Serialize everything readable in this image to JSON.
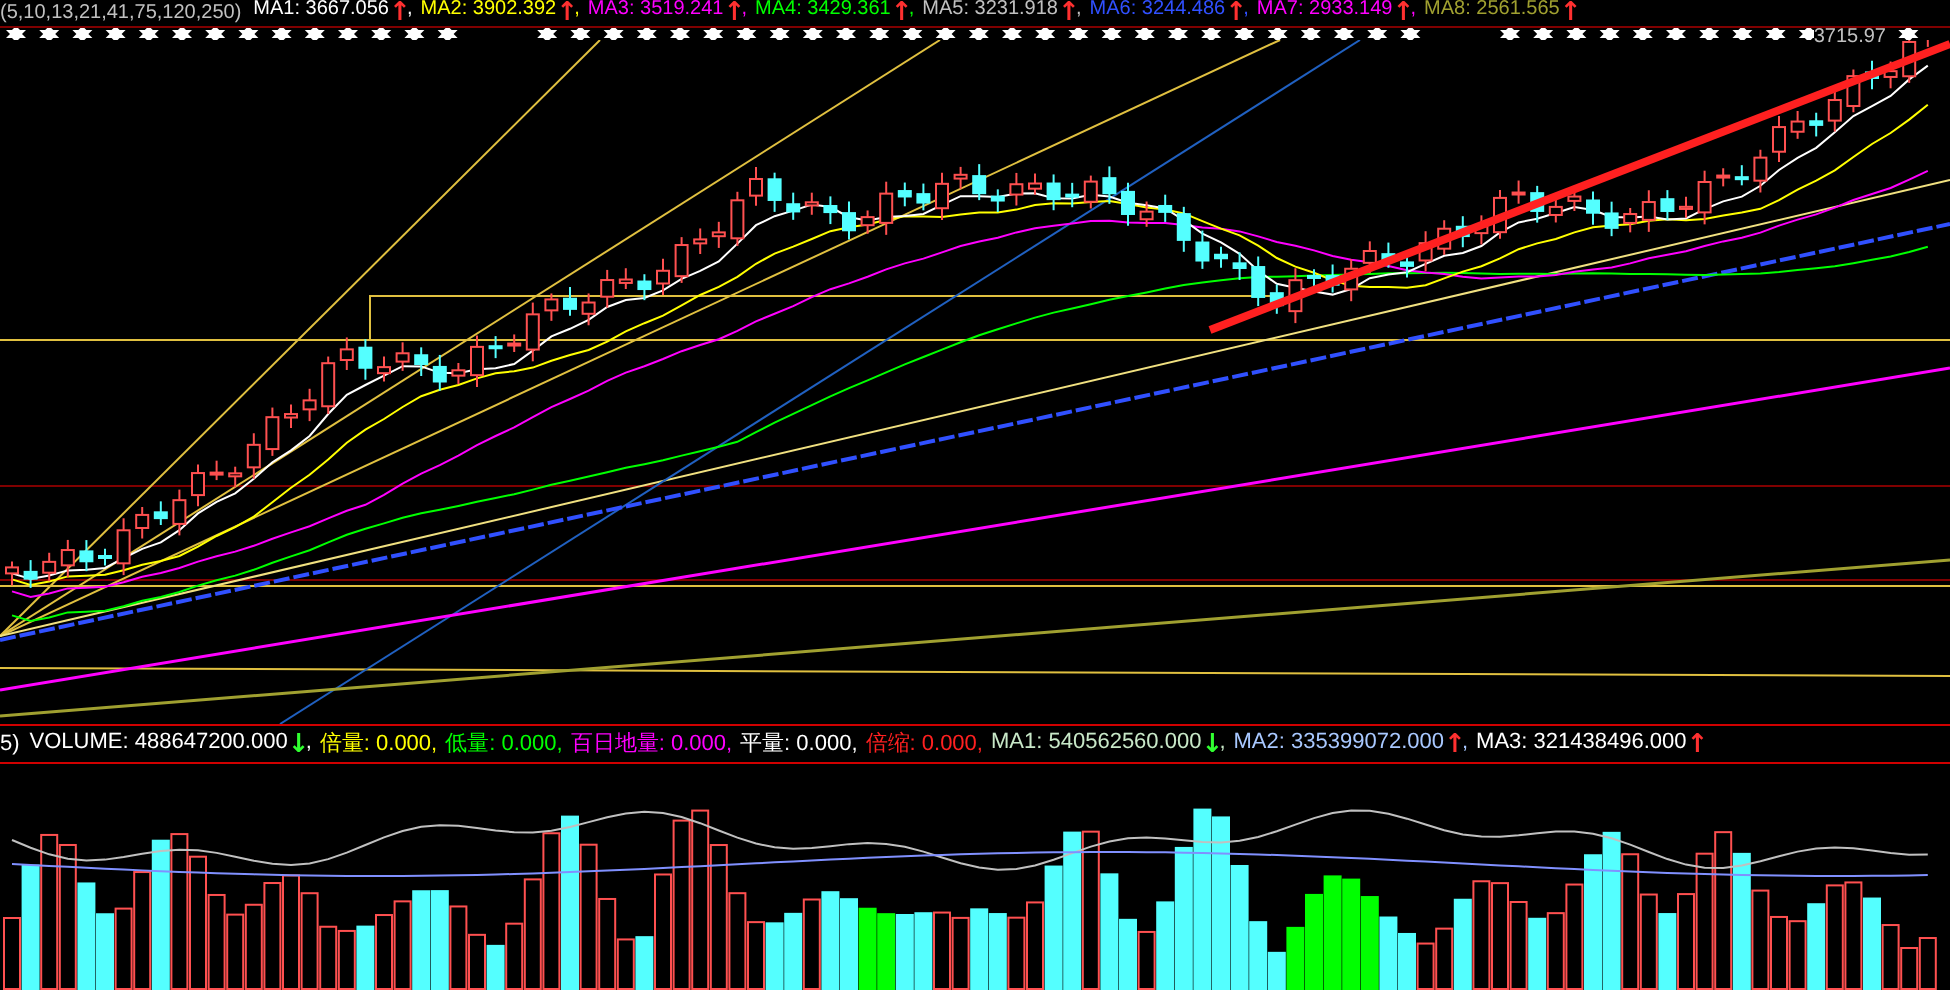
{
  "price_header": {
    "prefix": "(5,10,13,21,41,75,120,250)",
    "items": [
      {
        "label": "MA1:",
        "value": "3667.056",
        "color": "#ffffff",
        "arrow": {
          "text": "↑",
          "color": "#ff3030"
        },
        "end": ","
      },
      {
        "label": "MA2:",
        "value": "3902.392",
        "color": "#ffff00",
        "arrow": {
          "text": "↑",
          "color": "#ff3030"
        },
        "end": ","
      },
      {
        "label": "MA3:",
        "value": "3519.241",
        "color": "#ff00ff",
        "arrow": {
          "text": "↑",
          "color": "#ff3030"
        },
        "end": ","
      },
      {
        "label": "MA4:",
        "value": "3429.361",
        "color": "#00ff00",
        "arrow": {
          "text": "↑",
          "color": "#ff3030"
        },
        "end": ","
      },
      {
        "label": "MA5:",
        "value": "3231.918",
        "color": "#c0c0c0",
        "arrow": {
          "text": "↑",
          "color": "#ff3030"
        },
        "end": ","
      },
      {
        "label": "MA6:",
        "value": "3244.486",
        "color": "#3050ff",
        "arrow": {
          "text": "↑",
          "color": "#ff3030"
        },
        "end": ","
      },
      {
        "label": "MA7:",
        "value": "2933.149",
        "color": "#ff00ff",
        "arrow": {
          "text": "↑",
          "color": "#ff3030"
        },
        "end": ","
      },
      {
        "label": "MA8:",
        "value": "2561.565",
        "color": "#a0a030",
        "arrow": {
          "text": "↑",
          "color": "#ff3030"
        }
      }
    ]
  },
  "last_price": "3715.97",
  "volume_header": {
    "prefix": "5)",
    "items": [
      {
        "label": "VOLUME:",
        "value": "488647200.000",
        "color": "#ffffff",
        "arrow": {
          "text": "↓",
          "color": "#30ff30"
        },
        "end": ","
      },
      {
        "label": "倍量:",
        "value": "0.000",
        "color": "#ffff00",
        "end": ","
      },
      {
        "label": "低量:",
        "value": "0.000",
        "color": "#00ff00",
        "end": ","
      },
      {
        "label": "百日地量:",
        "value": "0.000",
        "color": "#ff00ff",
        "end": ","
      },
      {
        "label": "平量:",
        "value": "0.000",
        "color": "#ffffff",
        "end": ","
      },
      {
        "label": "倍缩:",
        "value": "0.000",
        "color": "#ff2020",
        "end": ","
      },
      {
        "label": "MA1:",
        "value": "540562560.000",
        "color": "#c8e8c8",
        "arrow": {
          "text": "↓",
          "color": "#30ff30"
        },
        "end": ","
      },
      {
        "label": "MA2:",
        "value": "335399072.000",
        "color": "#a8c8ff",
        "arrow": {
          "text": "↑",
          "color": "#ff3030"
        },
        "end": ","
      },
      {
        "label": "MA3:",
        "value": "321438496.000",
        "color": "#ffffff",
        "arrow": {
          "text": "↑",
          "color": "#ff3030"
        }
      }
    ]
  }
}
